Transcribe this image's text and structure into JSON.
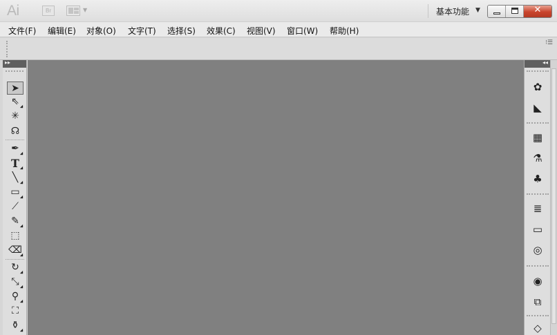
{
  "app": {
    "logo_text": "Ai",
    "bridge_label": "Br",
    "workspace_label": "基本功能",
    "workspace_arrow": "▼",
    "window_buttons": {
      "minimize": "minimize",
      "maximize": "maximize",
      "close": "✕"
    }
  },
  "menu": [
    {
      "label": "文件(F)"
    },
    {
      "label": "编辑(E)"
    },
    {
      "label": "对象(O)"
    },
    {
      "label": "文字(T)"
    },
    {
      "label": "选择(S)"
    },
    {
      "label": "效果(C)"
    },
    {
      "label": "视图(V)"
    },
    {
      "label": "窗口(W)"
    },
    {
      "label": "帮助(H)"
    }
  ],
  "tools": [
    {
      "name": "selection-tool-icon",
      "glyph": "➤",
      "selected": true
    },
    {
      "name": "direct-selection-tool-icon",
      "glyph": "⇖"
    },
    {
      "name": "magic-wand-tool-icon",
      "glyph": "✳"
    },
    {
      "name": "lasso-tool-icon",
      "glyph": "ଋ"
    },
    {
      "name": "pen-tool-icon",
      "glyph": "✒"
    },
    {
      "name": "type-tool-icon",
      "glyph": "T"
    },
    {
      "name": "line-segment-tool-icon",
      "glyph": "╲"
    },
    {
      "name": "rectangle-tool-icon",
      "glyph": "▭"
    },
    {
      "name": "paintbrush-tool-icon",
      "glyph": "⟋"
    },
    {
      "name": "pencil-tool-icon",
      "glyph": "✎"
    },
    {
      "name": "blob-brush-tool-icon",
      "glyph": "⬚"
    },
    {
      "name": "eraser-tool-icon",
      "glyph": "⌫"
    },
    {
      "name": "rotate-tool-icon",
      "glyph": "↻"
    },
    {
      "name": "scale-tool-icon",
      "glyph": "⤡"
    },
    {
      "name": "warp-tool-icon",
      "glyph": "⚲"
    },
    {
      "name": "free-transform-tool-icon",
      "glyph": "⛶"
    },
    {
      "name": "symbol-sprayer-tool-icon",
      "glyph": "⚱"
    }
  ],
  "dock_icons": [
    {
      "name": "color-palette-icon",
      "glyph": "🎨"
    },
    {
      "name": "color-guide-icon",
      "glyph": "◣"
    },
    {
      "name": "swatches-icon",
      "glyph": "▦"
    },
    {
      "name": "brushes-icon",
      "glyph": "⚗"
    },
    {
      "name": "symbols-icon",
      "glyph": "♣"
    },
    {
      "name": "stroke-icon",
      "glyph": "≡"
    },
    {
      "name": "gradient-icon",
      "glyph": "▭"
    },
    {
      "name": "transparency-icon",
      "glyph": "◎"
    },
    {
      "name": "appearance-icon",
      "glyph": "●"
    },
    {
      "name": "graphic-styles-icon",
      "glyph": "⧉"
    }
  ]
}
